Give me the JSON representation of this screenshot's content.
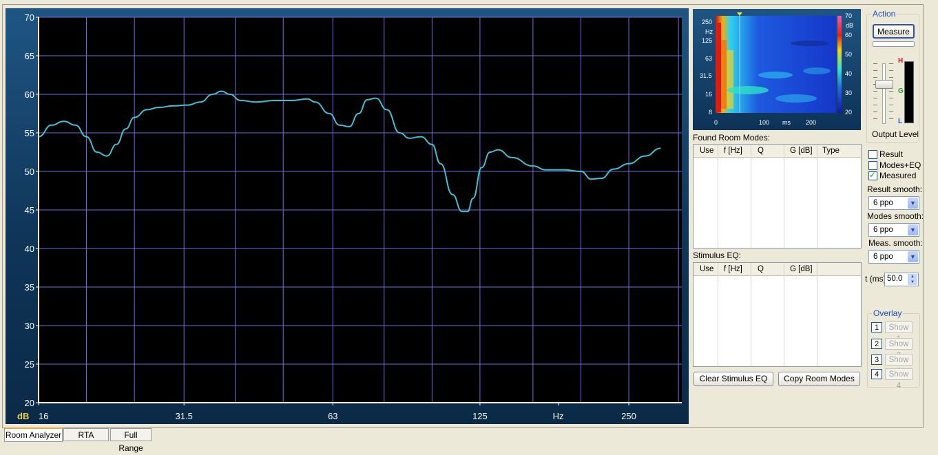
{
  "chart_data": {
    "type": "line",
    "x_scale": "log",
    "ylabel": "dB",
    "xlabel": "Hz",
    "ylim": [
      20,
      70
    ],
    "xlim": [
      16,
      320
    ],
    "y_ticks": [
      20,
      25,
      30,
      35,
      40,
      45,
      50,
      55,
      60,
      65,
      70
    ],
    "x_ticks": [
      {
        "label": "16",
        "value": 16
      },
      {
        "label": "31.5",
        "value": 31.5
      },
      {
        "label": "63",
        "value": 63
      },
      {
        "label": "125",
        "value": 125
      },
      {
        "label": "Hz",
        "value": 180
      },
      {
        "label": "250",
        "value": 250
      }
    ],
    "grid": true,
    "series": [
      {
        "color": "#3fc1d6",
        "points": [
          [
            16,
            54.5
          ],
          [
            17,
            56.0
          ],
          [
            18,
            56.5
          ],
          [
            19,
            56.0
          ],
          [
            20,
            54.5
          ],
          [
            21,
            52.5
          ],
          [
            22,
            52.0
          ],
          [
            23,
            53.5
          ],
          [
            24,
            55.5
          ],
          [
            25,
            57.0
          ],
          [
            26.5,
            58.0
          ],
          [
            28,
            58.3
          ],
          [
            30,
            58.5
          ],
          [
            32,
            58.6
          ],
          [
            34,
            59.0
          ],
          [
            36,
            60.0
          ],
          [
            37.5,
            60.4
          ],
          [
            39,
            60.0
          ],
          [
            41,
            59.2
          ],
          [
            44,
            59.0
          ],
          [
            48,
            59.2
          ],
          [
            52,
            59.2
          ],
          [
            56,
            59.4
          ],
          [
            58,
            59.0
          ],
          [
            62,
            57.5
          ],
          [
            65,
            56.0
          ],
          [
            68,
            55.8
          ],
          [
            71,
            57.5
          ],
          [
            74,
            59.3
          ],
          [
            77,
            59.5
          ],
          [
            81,
            58.0
          ],
          [
            86,
            55.0
          ],
          [
            90,
            54.3
          ],
          [
            95,
            54.5
          ],
          [
            100,
            53.5
          ],
          [
            104,
            51.0
          ],
          [
            110,
            47.0
          ],
          [
            115,
            44.8
          ],
          [
            118,
            44.8
          ],
          [
            121,
            46.5
          ],
          [
            126,
            50.5
          ],
          [
            131,
            52.5
          ],
          [
            136,
            52.8
          ],
          [
            145,
            51.8
          ],
          [
            160,
            50.7
          ],
          [
            170,
            50.2
          ],
          [
            185,
            50.2
          ],
          [
            200,
            50.0
          ],
          [
            210,
            49.0
          ],
          [
            220,
            49.1
          ],
          [
            233,
            50.3
          ],
          [
            250,
            51.0
          ],
          [
            270,
            52.0
          ],
          [
            290,
            53.0
          ]
        ]
      }
    ],
    "y_unit_label": "dB"
  },
  "spectrogram": {
    "y_ticks": [
      "250",
      "125",
      "63",
      "31.5",
      "16",
      "8"
    ],
    "y_unit": "Hz",
    "x_ticks": [
      "0",
      "100",
      "200"
    ],
    "x_unit": "ms",
    "scale_ticks": [
      "70",
      "60",
      "50",
      "40",
      "30",
      "20"
    ],
    "scale_unit": "dB"
  },
  "found_room_modes": {
    "title": "Found Room Modes:",
    "columns": [
      "Use",
      "f [Hz]",
      "Q",
      "G [dB]",
      "Type"
    ]
  },
  "stimulus_eq": {
    "title": "Stimulus EQ:",
    "columns": [
      "Use",
      "f [Hz]",
      "Q",
      "G [dB]"
    ]
  },
  "buttons": {
    "clear_stimulus": "Clear Stimulus EQ",
    "copy_room_modes": "Copy Room Modes",
    "measure": "Measure"
  },
  "action": {
    "title": "Action",
    "output_level": "Output Level",
    "meter_labels": [
      "H",
      "G",
      "L"
    ]
  },
  "checks": [
    {
      "label": "Result",
      "checked": false
    },
    {
      "label": "Modes+EQ",
      "checked": false
    },
    {
      "label": "Measured",
      "checked": true
    }
  ],
  "smoothing": {
    "result_label": "Result smooth:",
    "result_value": "6 ppo",
    "modes_label": "Modes smooth:",
    "modes_value": "6 ppo",
    "meas_label": "Meas. smooth:",
    "meas_value": "6 ppo",
    "t_label": "t (ms)",
    "t_value": "50.0"
  },
  "overlay": {
    "title": "Overlay",
    "items": [
      {
        "num": "1",
        "label": "Show 1"
      },
      {
        "num": "2",
        "label": "Show 2"
      },
      {
        "num": "3",
        "label": "Show 3"
      },
      {
        "num": "4",
        "label": "Show 4"
      }
    ]
  },
  "tabs": [
    "Room Analyzer",
    "RTA",
    "Full Range"
  ]
}
